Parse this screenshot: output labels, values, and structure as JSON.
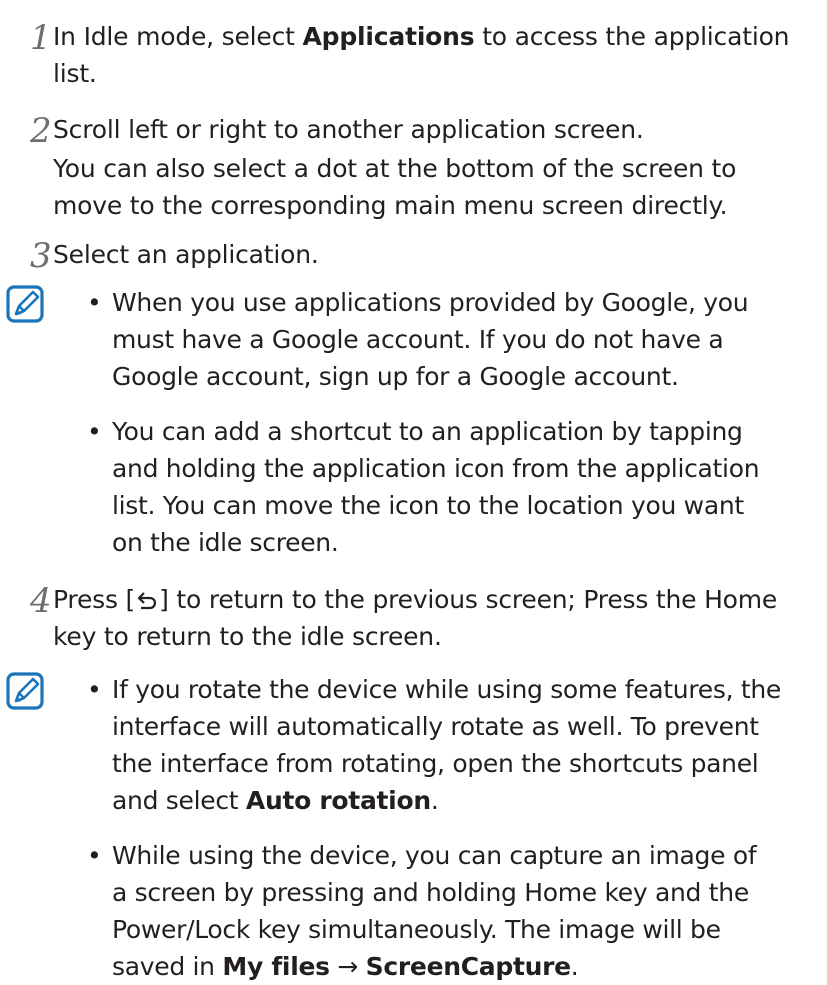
{
  "steps": [
    {
      "num": "1",
      "pre": "In Idle mode, select ",
      "bold": "Applications",
      "post_line1": " to access the application",
      "post_line2": "list."
    },
    {
      "num": "2",
      "line1": "Scroll left or right to another application screen.",
      "sub_line1": "You can also select a dot at the bottom of the screen to",
      "sub_line2": "move to the corresponding main menu screen directly."
    },
    {
      "num": "3",
      "line1": "Select an application."
    },
    {
      "num": "4",
      "pre": "Press [",
      "icon": "back-icon",
      "post_line1": "] to return to the previous screen; Press the Home",
      "post_line2": "key to return to the idle screen."
    }
  ],
  "note1": {
    "icon": "note-icon",
    "bullets": [
      {
        "lines": [
          "When you use applications provided by Google, you",
          "must have a Google account. If you do not have a",
          "Google account, sign up for a Google account."
        ]
      },
      {
        "lines": [
          "You can add a shortcut to an application by tapping",
          "and holding the application icon from the application",
          "list. You can move the icon to the location you want",
          "on the idle screen."
        ]
      }
    ]
  },
  "note2": {
    "icon": "note-icon",
    "bullets": [
      {
        "lines": [
          "If you rotate the device while using some features, the",
          "interface will automatically rotate as well. To prevent",
          "the interface from rotating, open the shortcuts panel"
        ],
        "last_pre": "and select ",
        "last_bold": "Auto rotation",
        "last_post": "."
      },
      {
        "lines": [
          "While using the device, you can capture an image of",
          "a screen by pressing and holding Home key and the",
          "Power/Lock key simultaneously. The image will be"
        ],
        "last_pre": "saved in ",
        "last_bold1": "My files",
        "last_arrow": " → ",
        "last_bold2": "ScreenCapture",
        "last_post": "."
      }
    ]
  },
  "bullet_char": "•",
  "colors": {
    "text": "#231f20",
    "step_number": "#6d6e71",
    "note_icon": "#1b75bb"
  }
}
